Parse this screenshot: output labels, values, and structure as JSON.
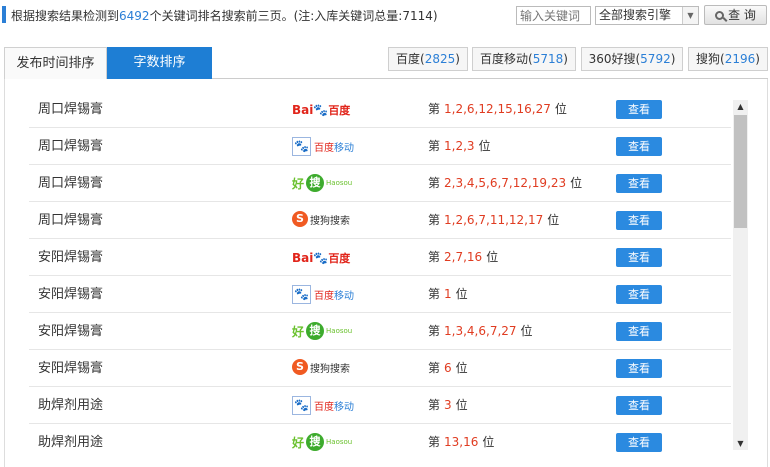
{
  "summary": {
    "prefix": "根据搜索结果检测到",
    "count": "6492",
    "suffix": "个关键词排名搜索前三页。(注:入库关键词总量:7114)"
  },
  "search": {
    "placeholder": "输入关键词",
    "engine_selected": "全部搜索引擎",
    "query_label": "查 询"
  },
  "tabs": [
    {
      "label": "发布时间排序",
      "active": false
    },
    {
      "label": "字数排序",
      "active": true
    }
  ],
  "engines": [
    {
      "label": "百度",
      "count": "2825"
    },
    {
      "label": "百度移动",
      "count": "5718"
    },
    {
      "label": "360好搜",
      "count": "5792"
    },
    {
      "label": "搜狗",
      "count": "2196"
    }
  ],
  "logos": {
    "baidu": {
      "bai": "Bai",
      "paw": "🐾",
      "du": "百度"
    },
    "baidu_mobile": {
      "paw": "🐾",
      "t1": "百度",
      "t2": "移动"
    },
    "haosou": {
      "hao": "好",
      "sou": "搜",
      "en": "Haosou"
    },
    "sogou": {
      "s": "S",
      "t": "搜狗搜索"
    }
  },
  "rank_prefix": "第",
  "rank_suffix": "位",
  "view_label": "查看",
  "rows": [
    {
      "keyword": "周口焊锡膏",
      "engine": "baidu",
      "positions": "1,2,6,12,15,16,27"
    },
    {
      "keyword": "周口焊锡膏",
      "engine": "baidu_mobile",
      "positions": "1,2,3"
    },
    {
      "keyword": "周口焊锡膏",
      "engine": "haosou",
      "positions": "2,3,4,5,6,7,12,19,23"
    },
    {
      "keyword": "周口焊锡膏",
      "engine": "sogou",
      "positions": "1,2,6,7,11,12,17"
    },
    {
      "keyword": "安阳焊锡膏",
      "engine": "baidu",
      "positions": "2,7,16"
    },
    {
      "keyword": "安阳焊锡膏",
      "engine": "baidu_mobile",
      "positions": "1"
    },
    {
      "keyword": "安阳焊锡膏",
      "engine": "haosou",
      "positions": "1,3,4,6,7,27"
    },
    {
      "keyword": "安阳焊锡膏",
      "engine": "sogou",
      "positions": "6"
    },
    {
      "keyword": "助焊剂用途",
      "engine": "baidu_mobile",
      "positions": "3"
    },
    {
      "keyword": "助焊剂用途",
      "engine": "haosou",
      "positions": "13,16"
    }
  ],
  "colors": {
    "accent": "#1e7ed4",
    "count_blue": "#2b7fd6",
    "rank_red": "#e03c21",
    "view_button": "#2b8ae0"
  }
}
